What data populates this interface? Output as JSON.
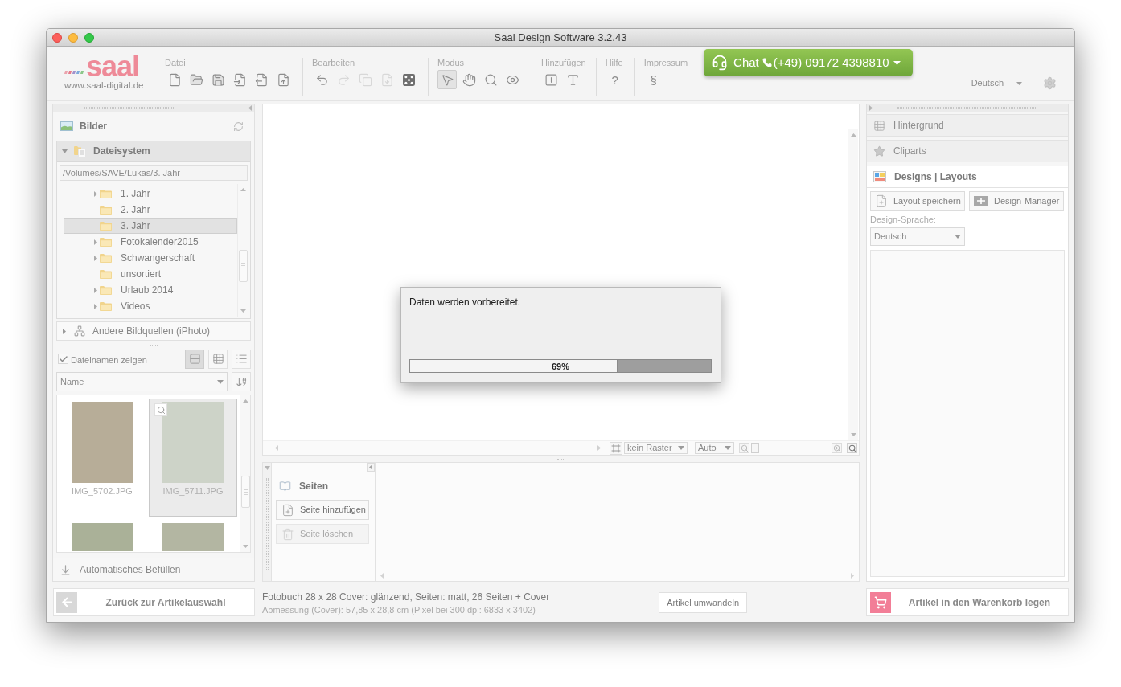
{
  "window": {
    "title": "Saal Design Software 3.2.43"
  },
  "logo": {
    "wordmark": "saal",
    "url": "www.saal-digital.de"
  },
  "toolbar": [
    {
      "label": "Datei",
      "tools": [
        {
          "kind": "new",
          "disabled": false,
          "selected": false
        },
        {
          "kind": "open",
          "disabled": false,
          "selected": false
        },
        {
          "kind": "save",
          "disabled": false,
          "selected": false
        },
        {
          "kind": "import",
          "disabled": false,
          "selected": false
        },
        {
          "kind": "export",
          "disabled": false,
          "selected": false
        },
        {
          "kind": "pdf",
          "disabled": false,
          "selected": false
        }
      ]
    },
    {
      "label": "Bearbeiten",
      "tools": [
        {
          "kind": "undo",
          "disabled": false,
          "selected": false
        },
        {
          "kind": "redo",
          "disabled": true,
          "selected": false
        },
        {
          "kind": "copy",
          "disabled": true,
          "selected": false
        },
        {
          "kind": "paste",
          "disabled": true,
          "selected": false
        },
        {
          "kind": "dice",
          "disabled": false,
          "selected": false
        }
      ]
    },
    {
      "label": "Modus",
      "tools": [
        {
          "kind": "select",
          "disabled": false,
          "selected": true
        },
        {
          "kind": "pan",
          "disabled": false,
          "selected": false
        },
        {
          "kind": "zoom",
          "disabled": false,
          "selected": false
        },
        {
          "kind": "preview",
          "disabled": false,
          "selected": false
        }
      ]
    },
    {
      "label": "Hinzufügen",
      "tools": [
        {
          "kind": "add-frame",
          "disabled": false,
          "selected": false
        },
        {
          "kind": "add-text",
          "disabled": false,
          "selected": false
        }
      ]
    },
    {
      "label": "Hilfe",
      "tools": [
        {
          "kind": "text",
          "text": "?",
          "disabled": false,
          "selected": false
        }
      ]
    },
    {
      "label": "Impressum",
      "tools": [
        {
          "kind": "text",
          "text": "§",
          "disabled": false,
          "selected": false
        }
      ]
    }
  ],
  "chat": {
    "label": "Chat",
    "phone": "(+49) 09172 4398810"
  },
  "language": {
    "value": "Deutsch"
  },
  "left_panel": {
    "title": "Bilder",
    "filesystem": {
      "title": "Dateisystem",
      "expanded": true,
      "path": "/Volumes/SAVE/Lukas/3. Jahr",
      "folders": [
        {
          "name": "1. Jahr",
          "expandable": true,
          "selected": false
        },
        {
          "name": "2. Jahr",
          "expandable": false,
          "selected": false
        },
        {
          "name": "3. Jahr",
          "expandable": false,
          "selected": true
        },
        {
          "name": "Fotokalender2015",
          "expandable": true,
          "selected": false
        },
        {
          "name": "Schwangerschaft",
          "expandable": true,
          "selected": false
        },
        {
          "name": "unsortiert",
          "expandable": false,
          "selected": false
        },
        {
          "name": "Urlaub 2014",
          "expandable": true,
          "selected": false
        },
        {
          "name": "Videos",
          "expandable": true,
          "selected": false
        }
      ]
    },
    "other_sources": {
      "title": "Andere Bildquellen (iPhoto)",
      "expanded": false
    },
    "show_filenames": {
      "label": "Dateinamen zeigen",
      "checked": true
    },
    "view_modes": [
      {
        "kind": "large-grid",
        "selected": true
      },
      {
        "kind": "small-grid",
        "selected": false
      },
      {
        "kind": "list",
        "selected": false
      }
    ],
    "sort_field": {
      "value": "Name"
    },
    "thumbnails": [
      {
        "name": "IMG_5702.JPG",
        "selected": false
      },
      {
        "name": "IMG_5711.JPG",
        "selected": true
      },
      {
        "selected": false
      },
      {
        "selected": false
      }
    ],
    "autofill": {
      "label": "Automatisches Befüllen"
    }
  },
  "canvas": {
    "grid": {
      "value": "kein Raster"
    },
    "zoom_mode": {
      "value": "Auto"
    },
    "zoom_slider": {
      "level": 0
    }
  },
  "progress_dialog": {
    "message": "Daten werden vorbereitet.",
    "progress": {
      "level": 0.69,
      "reading": "69%"
    }
  },
  "pages_panel": {
    "title": "Seiten",
    "buttons": [
      {
        "label": "Seite hinzufügen",
        "kind": "add",
        "disabled": false
      },
      {
        "label": "Seite löschen",
        "kind": "delete",
        "disabled": true
      }
    ]
  },
  "right_panel": {
    "sections": [
      {
        "title": "Hintergrund",
        "kind": "background",
        "expanded": false
      },
      {
        "title": "Cliparts",
        "kind": "cliparts",
        "expanded": false
      },
      {
        "title": "Designs | Layouts",
        "kind": "designs",
        "expanded": true
      }
    ],
    "buttons": [
      {
        "label": "Layout speichern",
        "kind": "save-layout"
      },
      {
        "label": "Design-Manager",
        "kind": "manager"
      }
    ],
    "language_label": "Design-Sprache:",
    "language": {
      "value": "Deutsch"
    }
  },
  "footer": {
    "back_button": "Zurück zur Artikelauswahl",
    "product": "Fotobuch 28 x 28 Cover: glänzend, Seiten: matt, 26 Seiten + Cover",
    "dimensions": "Abmessung (Cover): 57,85 x 28,8 cm (Pixel bei 300 dpi: 6833 x 3402)",
    "convert_button": "Artikel umwandeln",
    "cart_button": "Artikel in den Warenkorb legen"
  }
}
